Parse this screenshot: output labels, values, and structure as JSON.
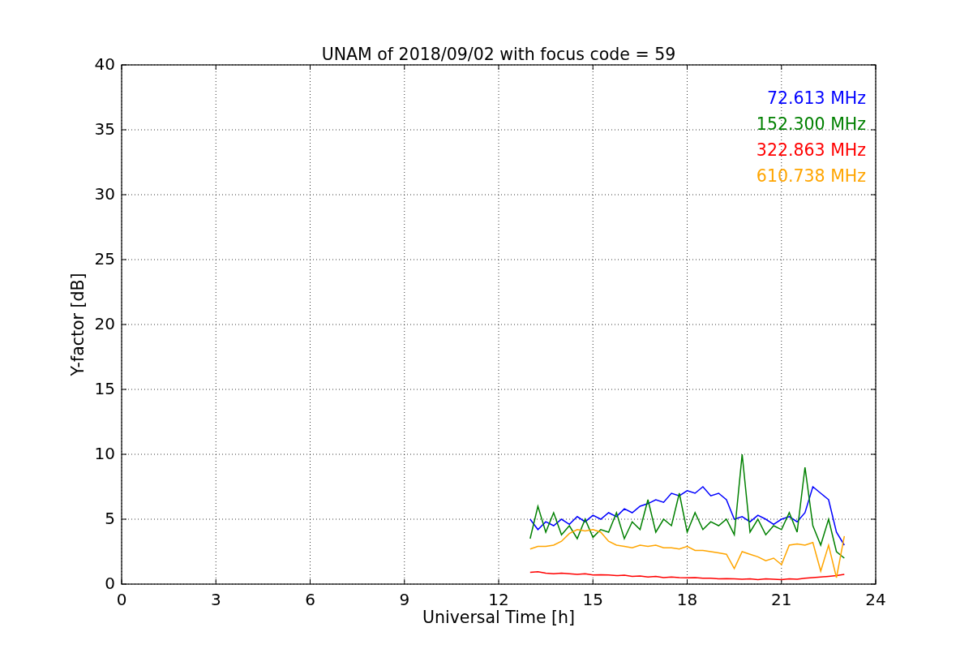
{
  "figure": {
    "chart_data": {
      "type": "line",
      "title": "UNAM of 2018/09/02 with focus code = 59",
      "xlabel": "Universal Time [h]",
      "ylabel": "Y-factor [dB]",
      "x": [
        13,
        13.25,
        13.5,
        13.75,
        14,
        14.25,
        14.5,
        14.75,
        15,
        15.25,
        15.5,
        15.75,
        16,
        16.25,
        16.5,
        16.75,
        17,
        17.25,
        17.5,
        17.75,
        18,
        18.25,
        18.5,
        18.75,
        19,
        19.25,
        19.5,
        19.75,
        20,
        20.25,
        20.5,
        20.75,
        21,
        21.25,
        21.5,
        21.75,
        22,
        22.25,
        22.5,
        22.75,
        23
      ],
      "series": [
        {
          "name": "72.613 MHz",
          "color": "#0000ff",
          "values": [
            5,
            4.2,
            4.8,
            4.5,
            5,
            4.6,
            5.2,
            4.8,
            5.3,
            5,
            5.5,
            5.2,
            5.8,
            5.5,
            6,
            6.2,
            6.5,
            6.3,
            7,
            6.8,
            7.2,
            7,
            7.5,
            6.8,
            7,
            6.5,
            5,
            5.2,
            4.8,
            5.3,
            5,
            4.6,
            5,
            5.2,
            4.8,
            5.5,
            7.5,
            7,
            6.5,
            4,
            3
          ]
        },
        {
          "name": "152.300 MHz",
          "color": "#008000",
          "values": [
            3.5,
            6,
            4,
            5.5,
            3.8,
            4.5,
            3.5,
            5,
            3.6,
            4.2,
            4,
            5.5,
            3.5,
            4.8,
            4.2,
            6.5,
            4,
            5,
            4.5,
            7,
            4,
            5.5,
            4.2,
            4.8,
            4.5,
            5,
            3.8,
            10,
            4,
            5,
            3.8,
            4.5,
            4.2,
            5.5,
            4,
            9,
            4.5,
            3,
            5,
            2.5,
            2
          ]
        },
        {
          "name": "322.863 MHz",
          "color": "#ff0000",
          "values": [
            0.9,
            0.95,
            0.85,
            0.8,
            0.85,
            0.8,
            0.75,
            0.8,
            0.7,
            0.72,
            0.7,
            0.65,
            0.68,
            0.6,
            0.62,
            0.55,
            0.6,
            0.5,
            0.55,
            0.5,
            0.48,
            0.5,
            0.45,
            0.45,
            0.4,
            0.42,
            0.4,
            0.38,
            0.4,
            0.35,
            0.4,
            0.38,
            0.35,
            0.4,
            0.38,
            0.45,
            0.5,
            0.55,
            0.6,
            0.65,
            0.75
          ]
        },
        {
          "name": "610.738 MHz",
          "color": "#ffa500",
          "values": [
            2.7,
            2.9,
            2.9,
            3,
            3.3,
            3.9,
            4.2,
            4.1,
            4.2,
            4,
            3.3,
            3,
            2.9,
            2.8,
            3,
            2.9,
            3,
            2.8,
            2.8,
            2.7,
            2.9,
            2.6,
            2.6,
            2.5,
            2.4,
            2.3,
            1.2,
            2.5,
            2.3,
            2.1,
            1.8,
            2,
            1.5,
            3,
            3.1,
            3,
            3.2,
            1,
            3,
            0.5,
            3.7
          ]
        }
      ],
      "grid": true,
      "xlim": [
        0,
        24
      ],
      "ylim": [
        0,
        40
      ],
      "xticks": [
        0,
        3,
        6,
        9,
        12,
        15,
        18,
        21,
        24
      ],
      "yticks": [
        0,
        5,
        10,
        15,
        20,
        25,
        30,
        35,
        40
      ]
    }
  }
}
